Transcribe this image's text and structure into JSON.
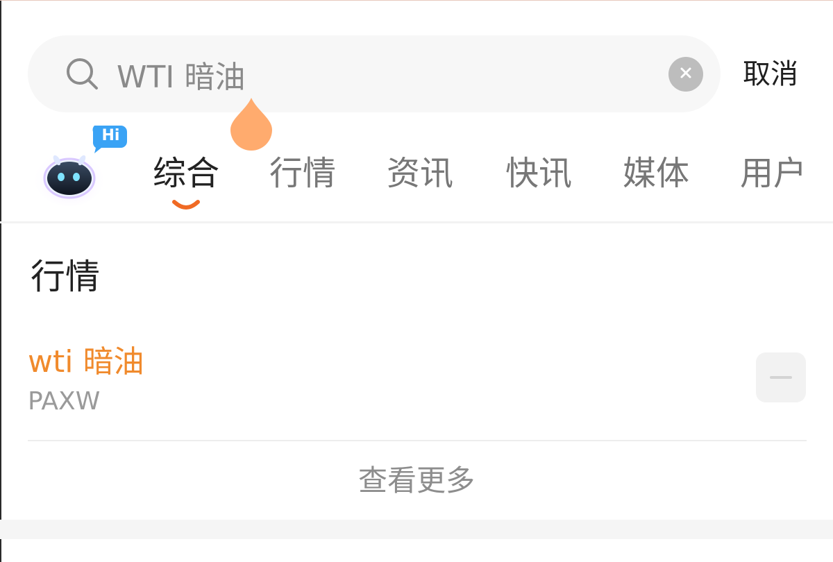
{
  "search": {
    "value": "WTI 暗油",
    "cancel_label": "取消"
  },
  "assistant": {
    "badge": "Hi"
  },
  "tabs": [
    {
      "label": "综合",
      "active": true
    },
    {
      "label": "行情",
      "active": false
    },
    {
      "label": "资讯",
      "active": false
    },
    {
      "label": "快讯",
      "active": false
    },
    {
      "label": "媒体",
      "active": false
    },
    {
      "label": "用户",
      "active": false
    }
  ],
  "market_section": {
    "title": "行情",
    "results": [
      {
        "name": "wti 暗油",
        "code": "PAXW"
      }
    ],
    "more_label": "查看更多"
  },
  "colors": {
    "accent": "#f08a2c",
    "cursor_drop": "#ffab6e",
    "badge_blue": "#3aa3f5"
  },
  "icons": {
    "search": "search-icon",
    "clear": "clear-icon",
    "watch": "minus-icon"
  }
}
